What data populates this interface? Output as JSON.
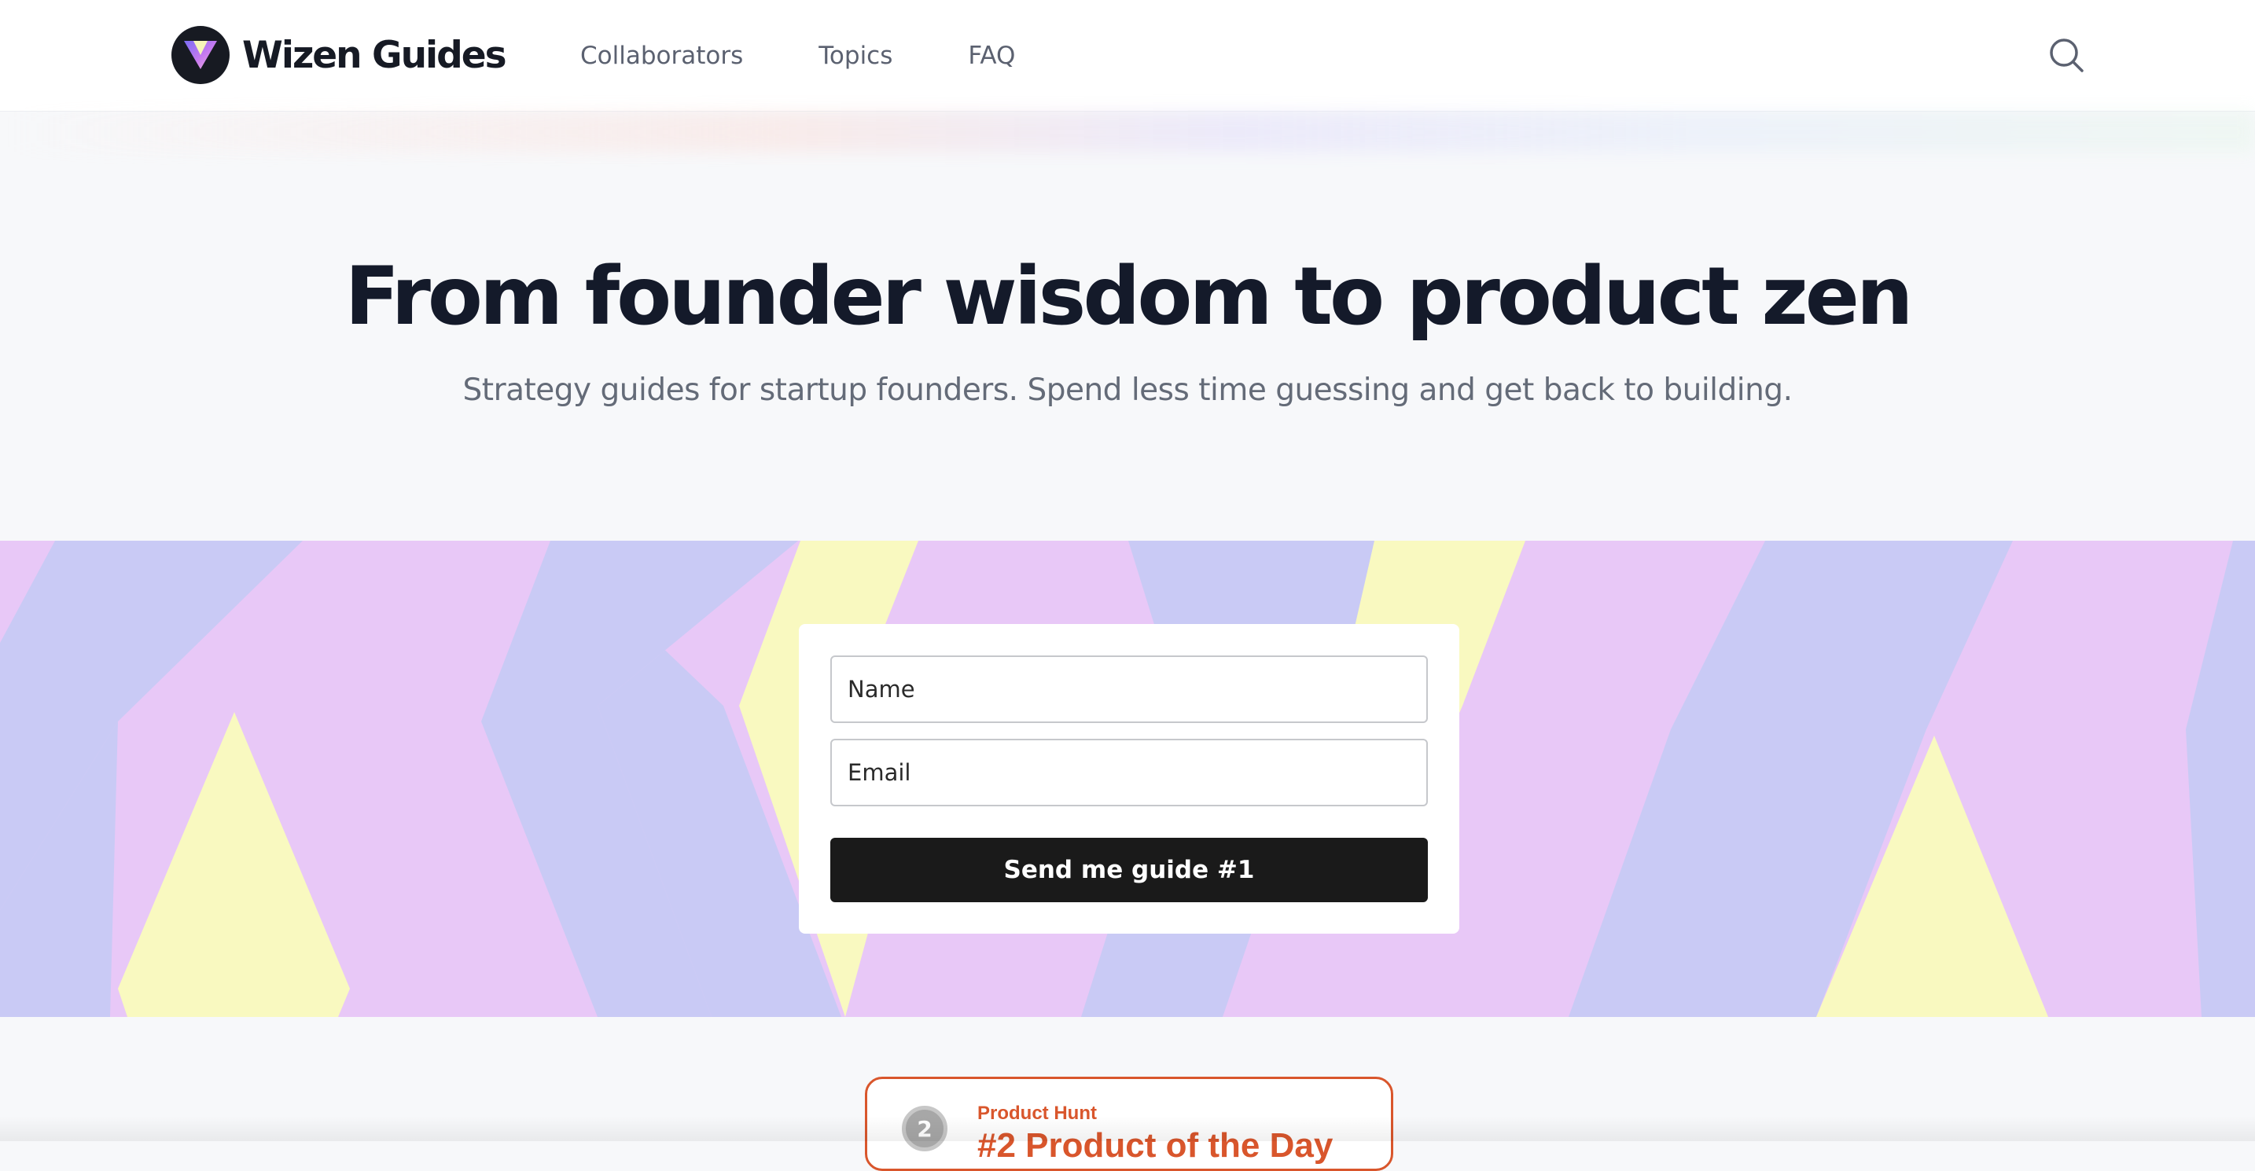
{
  "header": {
    "brand": "Wizen Guides",
    "logo_icon": "wizen-w-logo-icon",
    "nav": [
      {
        "label": "Collaborators"
      },
      {
        "label": "Topics"
      },
      {
        "label": "FAQ"
      }
    ],
    "search_icon": "search-icon"
  },
  "hero": {
    "title": "From founder wisdom to product zen",
    "subtitle": "Strategy guides for startup founders. Spend less time guessing and get back to building."
  },
  "signup": {
    "name_placeholder": "Name",
    "email_placeholder": "Email",
    "submit_label": "Send me guide #1"
  },
  "product_hunt": {
    "rank": "2",
    "label": "Product Hunt",
    "title": "#2 Product of the Day"
  },
  "colors": {
    "pattern_lavender": "#c9caf5",
    "pattern_pink": "#e8c8f7",
    "pattern_yellow": "#f9f9c0",
    "button_dark": "#1a1a1a",
    "product_hunt_orange": "#d9562c",
    "title_navy": "#141a2a"
  }
}
